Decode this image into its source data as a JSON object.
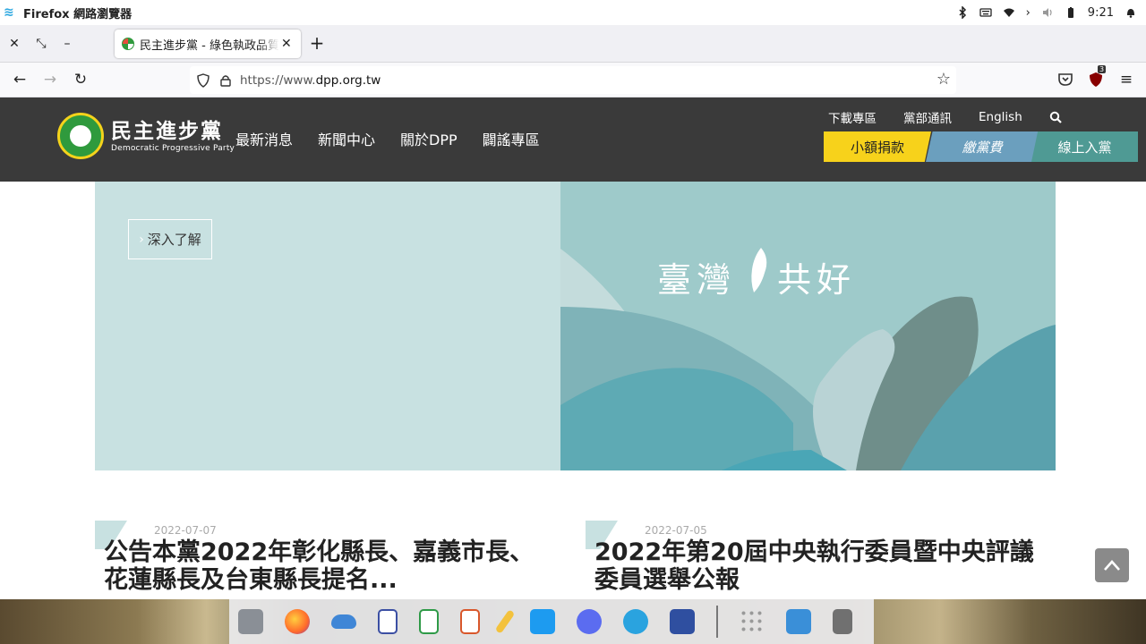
{
  "os": {
    "app_title": "Firefox 網路瀏覽器",
    "clock": "9:21"
  },
  "browser": {
    "tab_title": "民主進步黨 - 綠色執政品質保證",
    "url_prefix": "https://www.",
    "url_domain": "dpp.org.tw",
    "extension_badge": "3"
  },
  "site": {
    "logo_cn": "民主進步黨",
    "logo_en": "Democratic Progressive Party",
    "main_nav": [
      "最新消息",
      "新聞中心",
      "關於DPP",
      "闢謠專區"
    ],
    "util_nav": [
      "下載專區",
      "黨部通訊",
      "English"
    ],
    "cta": {
      "donate": "小額捐款",
      "fee": "繳黨費",
      "join": "線上入黨"
    }
  },
  "banner": {
    "more_button": "深入了解",
    "slogan_left": "臺灣",
    "slogan_right": "共好"
  },
  "news": [
    {
      "date": "2022-07-07",
      "title": "公告本黨2022年彰化縣長、嘉義市長、花蓮縣長及台東縣長提名..."
    },
    {
      "date": "2022-07-05",
      "title": "2022年第20屆中央執行委員暨中央評議委員選舉公報"
    }
  ],
  "colors": {
    "header_bg": "#3a3a3a",
    "donate": "#f7d21b",
    "fee": "#6b9fbe",
    "join": "#4f9a94",
    "banner_left": "#c8e1e1",
    "banner_right": "#9ecaca"
  },
  "dock_icons": [
    "files-icon",
    "firefox-icon",
    "cloud-icon",
    "writer-icon",
    "calc-icon",
    "impress-icon",
    "notes-icon",
    "twitter-icon",
    "messenger-icon",
    "telegram-icon",
    "wps-icon",
    "app-grid-icon",
    "downloads-icon",
    "trash-icon"
  ]
}
